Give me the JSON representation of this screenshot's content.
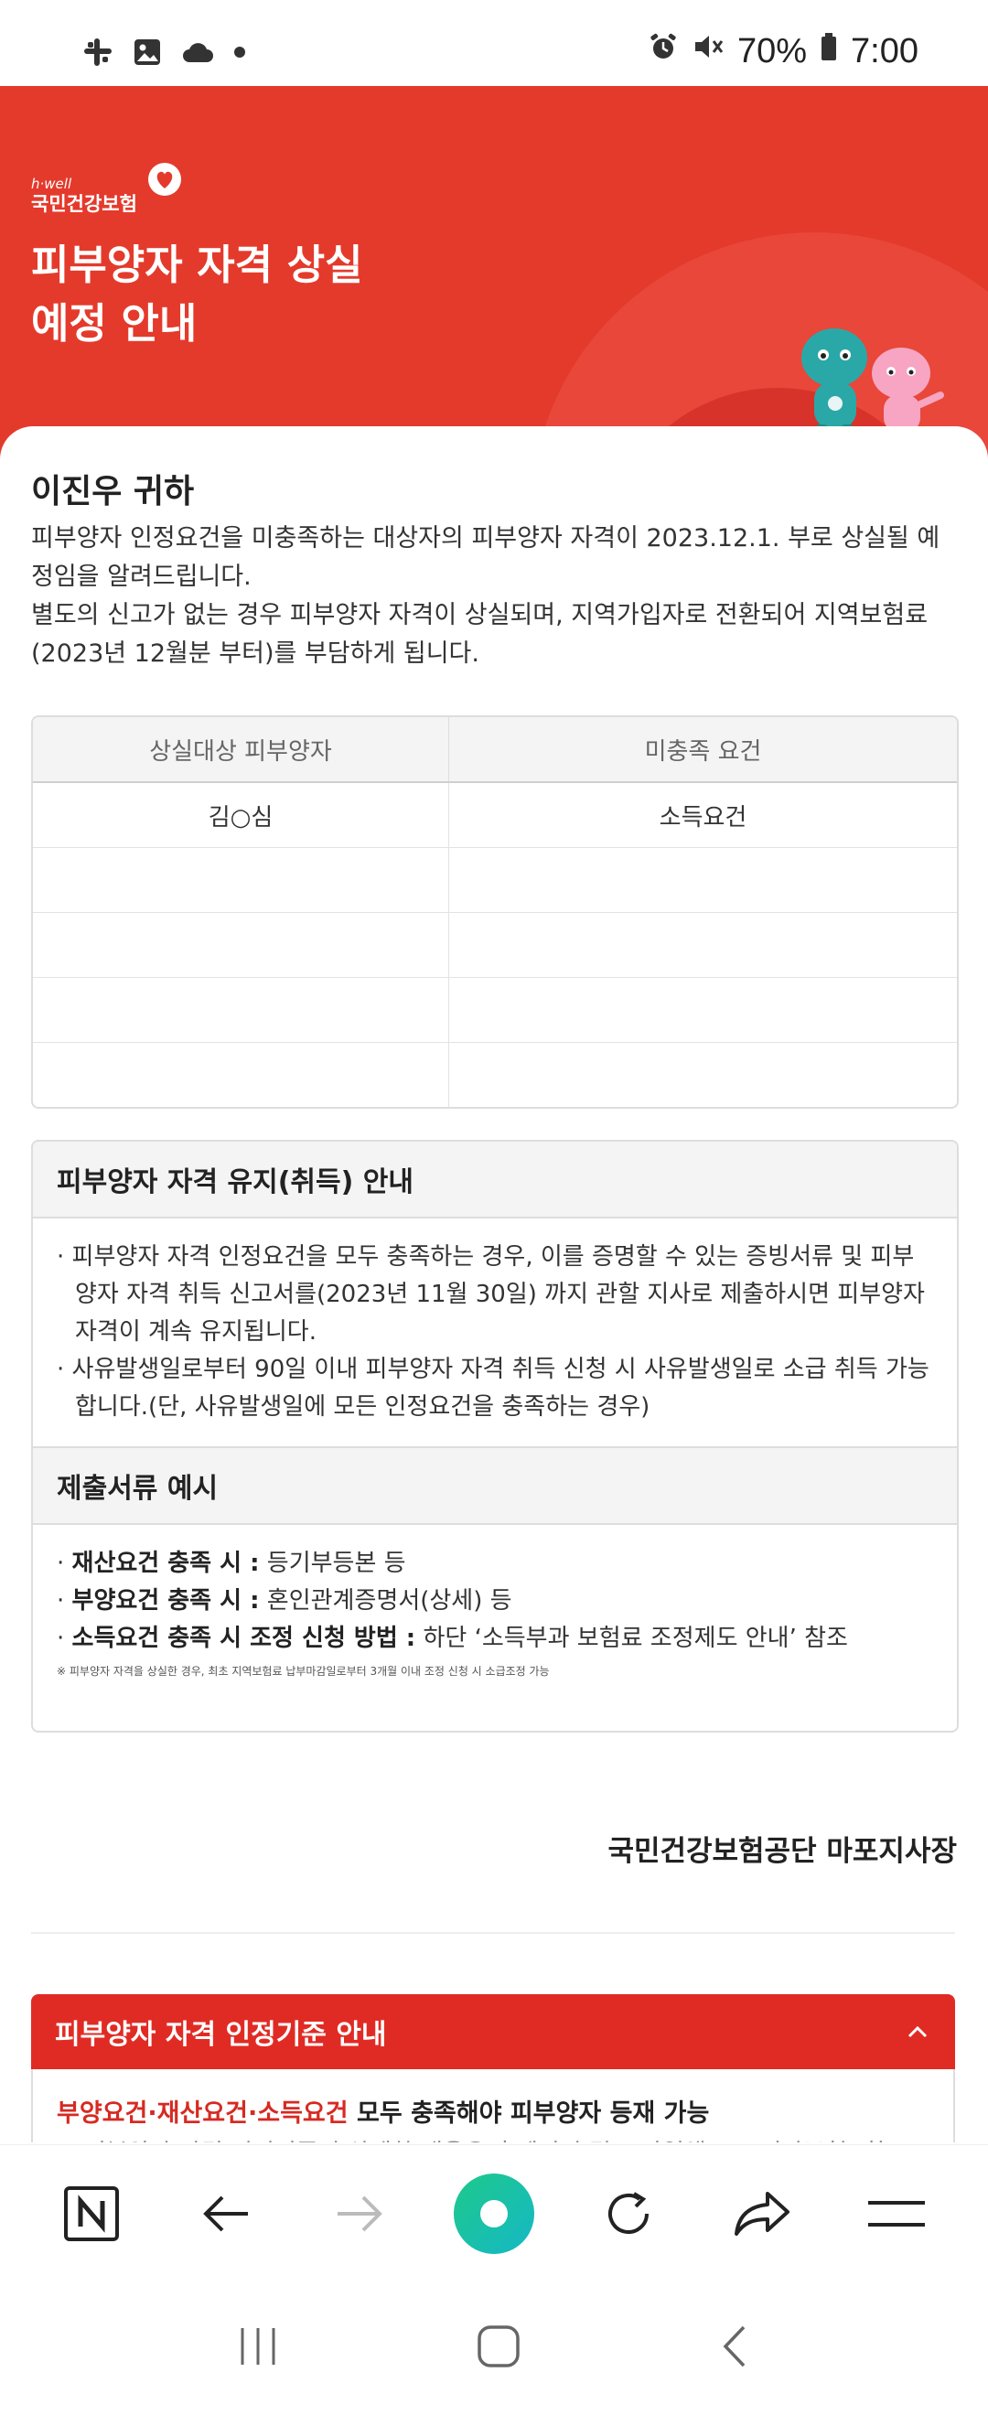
{
  "status_bar": {
    "battery": "70%",
    "time": "7:00"
  },
  "hero": {
    "logo_sub": "h·well",
    "logo_main": "국민건강보험",
    "title_line1": "피부양자 자격 상실",
    "title_line2": "예정 안내"
  },
  "notice": {
    "greeting": "이진우 귀하",
    "intro_p1": "피부양자 인정요건을 미충족하는 대상자의 피부양자 자격이 2023.12.1. 부로 상실될 예정임을 알려드립니다.",
    "intro_p2": "별도의 신고가 없는 경우 피부양자 자격이 상실되며, 지역가입자로 전환되어 지역보험료(2023년 12월분 부터)를 부담하게 됩니다."
  },
  "table": {
    "headers": [
      "상실대상 피부양자",
      "미충족 요건"
    ],
    "rows": [
      [
        "김○심",
        "소득요건"
      ],
      [
        "",
        ""
      ],
      [
        "",
        ""
      ],
      [
        "",
        ""
      ],
      [
        "",
        ""
      ]
    ]
  },
  "maintain_section": {
    "title": "피부양자 자격 유지(취득) 안내",
    "bullet1": "· 피부양자 자격 인정요건을 모두 충족하는 경우, 이를 증명할 수 있는 증빙서류 및 피부양자 자격 취득 신고서를(2023년 11월 30일) 까지 관할 지사로 제출하시면 피부양자 자격이 계속 유지됩니다.",
    "bullet2": "· 사유발생일로부터 90일 이내 피부양자 자격 취득 신청 시 사유발생일로 소급 취득 가능합니다.(단, 사유발생일에 모든 인정요건을 충족하는 경우)"
  },
  "documents_section": {
    "title": "제출서류 예시",
    "item1_label": "재산요건 충족 시 :",
    "item1_value": " 등기부등본 등",
    "item2_label": "부양요건 충족 시 :",
    "item2_value": " 혼인관계증명서(상세) 등",
    "item3_label": "소득요건 충족 시 조정 신청 방법 :",
    "item3_value": " 하단 ‘소득부과 보험료 조정제도 안내’ 참조",
    "footnote": "※ 피부양자 자격을 상실한 경우, 최초 지역보험료 납부마감일로부터 3개월 이내 조정 신청 시 소급조정 가능"
  },
  "signature": "국민건강보험공단 마포지사장",
  "accordion": {
    "title": "피부양자 자격 인정기준 안내",
    "highlight": "부양요건·재산요건·소득요건",
    "rest": " 모두 충족해야 피부양자 등재 가능",
    "faded": "※ 피부양자 자격 인정기준의 상세한 내용은 홈페이지 및 모바일앱(The건강보험) 참조"
  },
  "icons": {
    "status_left": [
      "slack-icon",
      "image-icon",
      "cloud-icon",
      "dot-icon"
    ],
    "status_right": [
      "alarm-icon",
      "mute-icon",
      "battery-icon"
    ],
    "toolbar": [
      "naver-icon",
      "back-icon",
      "forward-icon",
      "green-dot-icon",
      "reload-icon",
      "share-icon",
      "menu-icon"
    ],
    "navbar": [
      "recent-apps-icon",
      "home-icon",
      "nav-back-icon"
    ]
  },
  "colors": {
    "brand_red": "#e43a2c",
    "accordion_red": "#e02b24",
    "green_button": "#19c3a0"
  }
}
